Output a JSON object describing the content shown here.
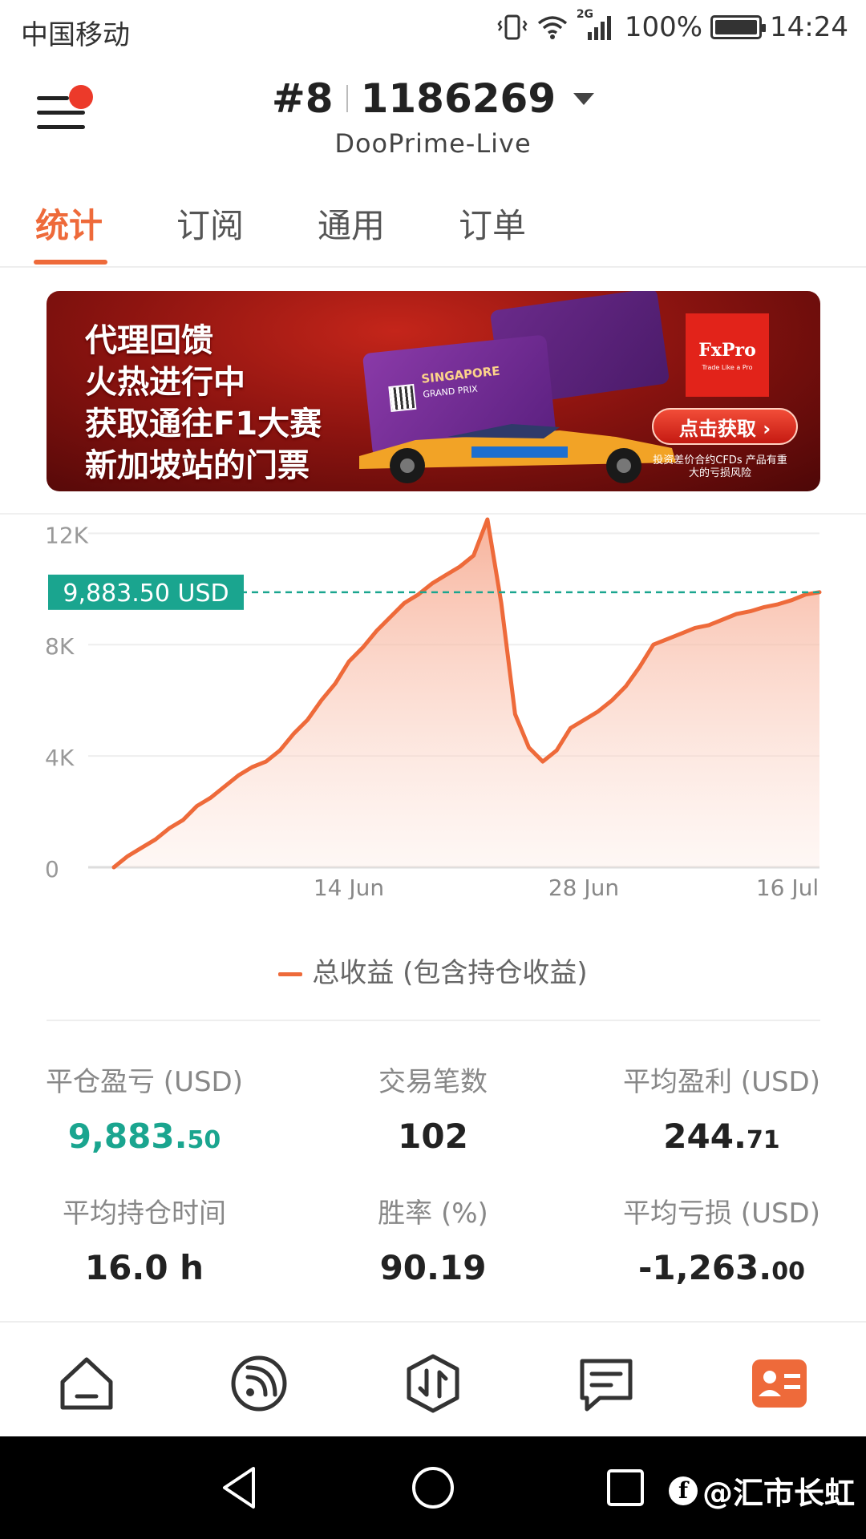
{
  "status_bar": {
    "carrier": "中国移动",
    "network": "2G",
    "battery": "100%",
    "battery_level": 1.0,
    "time": "14:24"
  },
  "header": {
    "account_index": "#8",
    "account_id": "1186269",
    "server": "DooPrime-Live"
  },
  "tabs": [
    {
      "label": "统计",
      "active": true
    },
    {
      "label": "订阅",
      "active": false
    },
    {
      "label": "通用",
      "active": false
    },
    {
      "label": "订单",
      "active": false
    }
  ],
  "banner": {
    "lines": [
      "代理回馈",
      "火热进行中",
      "获取通往F1大赛",
      "新加坡站的门票"
    ],
    "brand": "FxPro",
    "brand_tagline": "Trade Like a Pro",
    "ticket_title": "SINGAPORE",
    "ticket_subtitle": "GRAND PRIX",
    "cta": "点击获取 ›",
    "risk_note": "投资差价合约CFDs 产品有重大的亏损风险"
  },
  "current_value_label": "9,883.50 USD",
  "chart_data": {
    "type": "area",
    "x_tick_labels": [
      "14 Jun",
      "28 Jun",
      "16 Jul"
    ],
    "y_tick_labels": [
      "0",
      "4K",
      "8K",
      "12K"
    ],
    "ylim": [
      0,
      12500
    ],
    "grid": true,
    "reference_line": 9883.5,
    "series": [
      {
        "name": "总收益 (包含持仓收益)",
        "color": "#ee6a3a",
        "values": [
          0,
          400,
          700,
          1000,
          1400,
          1700,
          2200,
          2500,
          2900,
          3300,
          3600,
          3800,
          4200,
          4800,
          5300,
          6000,
          6600,
          7400,
          7900,
          8500,
          9000,
          9500,
          9800,
          10200,
          10500,
          10800,
          11200,
          12500,
          9500,
          5500,
          4300,
          3800,
          4200,
          5000,
          5300,
          5600,
          6000,
          6500,
          7200,
          8000,
          8200,
          8400,
          8600,
          8700,
          8900,
          9100,
          9200,
          9350,
          9450,
          9600,
          9800,
          9883.5
        ]
      }
    ]
  },
  "legend": {
    "label": "总收益 (包含持仓收益)"
  },
  "stats": [
    {
      "label": "平仓盈亏 (USD)",
      "int": "9,883.",
      "dec": "50",
      "green": true
    },
    {
      "label": "交易笔数",
      "int": "102",
      "dec": "",
      "green": false
    },
    {
      "label": "平均盈利 (USD)",
      "int": "244.",
      "dec": "71",
      "green": false
    },
    {
      "label": "平均持仓时间",
      "int": "16.0 h",
      "dec": "",
      "green": false
    },
    {
      "label": "胜率 (%)",
      "int": "90.19",
      "dec": "",
      "green": false
    },
    {
      "label": "平均亏损 (USD)",
      "int": "-1,263.",
      "dec": "00",
      "green": false
    }
  ],
  "bottom_nav": [
    {
      "name": "home-icon",
      "active": false
    },
    {
      "name": "signal-feed-icon",
      "active": false
    },
    {
      "name": "trade-icon",
      "active": false
    },
    {
      "name": "message-icon",
      "active": false
    },
    {
      "name": "profile-card-icon",
      "active": true
    }
  ],
  "watermark": "@汇市长虹",
  "colors": {
    "accent": "#ee6a3a",
    "green": "#1aa58f",
    "badge_red": "#ec3a2a"
  }
}
